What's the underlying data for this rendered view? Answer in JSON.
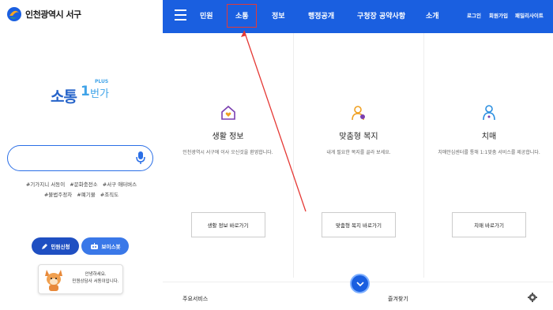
{
  "logo": {
    "text": "인천광역시 서구"
  },
  "brand": {
    "main": "소통",
    "num": "1",
    "sub": "번가",
    "plus": "PLUS"
  },
  "search": {
    "placeholder": ""
  },
  "tags": [
    "#기가지니 서동이",
    "#문화충전소",
    "#서구 애터버스",
    "#불법주정차",
    "#폐기물",
    "#조직도"
  ],
  "buttons": {
    "apply": "민원신청",
    "voice": "보이스봇"
  },
  "bubble": {
    "line1": "안녕하세요.",
    "line2": "민원상담사 서동이입니다."
  },
  "nav": {
    "items": [
      "민원",
      "소통",
      "정보",
      "행정공개",
      "구청장 공약사항",
      "소개"
    ],
    "selected": "소통",
    "util": [
      "로그인",
      "회원가입",
      "패밀리사이트"
    ]
  },
  "columns": [
    {
      "title": "생활 정보",
      "desc": "인천광역시 서구에 이사 오신것을 환영합니다.",
      "button": "생활 정보 바로가기",
      "icon": "house-heart-icon",
      "color": "#7b3fb0"
    },
    {
      "title": "맞춤형 복지",
      "desc": "내게 필요한 복지를 골라 보세요.",
      "button": "맞춤형 복지 바로가기",
      "icon": "person-welfare-icon",
      "color": "#f0a020"
    },
    {
      "title": "치매",
      "desc": "치매안심센터를 통해 1:1맞춤 서비스를 제공합니다.",
      "button": "치매 바로가기",
      "icon": "person-outline-icon",
      "color": "#2b8fe0"
    }
  ],
  "bottom": {
    "left": "주요서비스",
    "mid": "즐겨찾기"
  },
  "colors": {
    "nav": "#1a5fe0",
    "highlight": "#e53935",
    "accent": "#2563c9"
  }
}
